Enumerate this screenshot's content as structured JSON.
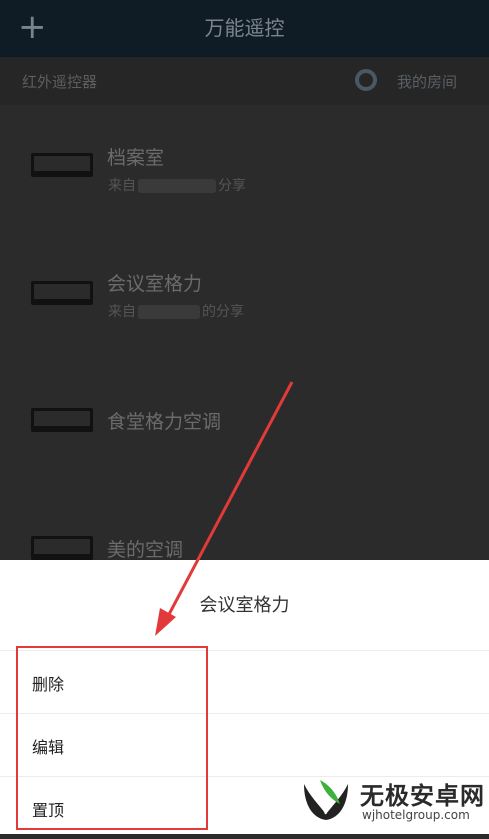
{
  "appbar": {
    "title": "万能遥控",
    "add_icon": "plus-icon"
  },
  "subhead": {
    "left_label": "红外遥控器",
    "right_label": "我的房间",
    "room_icon": "ring-icon"
  },
  "devices": [
    {
      "name": "档案室",
      "sub_prefix": "来自",
      "sub_suffix": "分享"
    },
    {
      "name": "会议室格力",
      "sub_prefix": "来自",
      "sub_suffix": "的分享"
    },
    {
      "name": "食堂格力空调"
    },
    {
      "name": "美的空调"
    }
  ],
  "sheet": {
    "title": "会议室格力",
    "options": [
      "删除",
      "编辑",
      "置顶"
    ]
  },
  "annotation": {
    "box_color": "#e23a3a",
    "arrow_color": "#e23a3a"
  },
  "watermark": {
    "brand": "无极安卓网",
    "url": "wjhotelgroup.com"
  }
}
